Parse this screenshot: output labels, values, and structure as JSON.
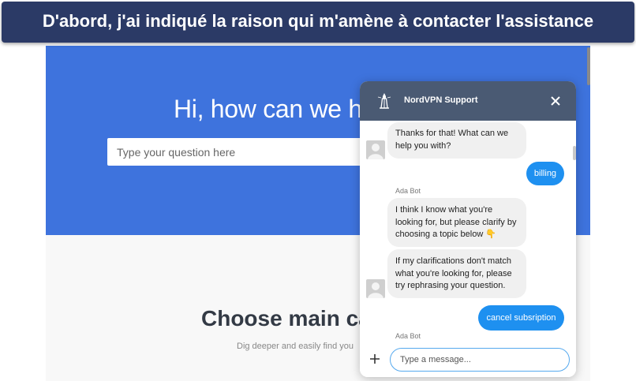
{
  "banner": {
    "text": "D'abord, j'ai indiqué la raison qui m'amène à contacter l'assistance"
  },
  "page": {
    "hero_title": "Hi, how can we h",
    "search_placeholder": "Type your question here",
    "categories_title": "Choose main ca",
    "categories_subtitle": "Dig deeper and easily find you"
  },
  "chat": {
    "title": "NordVPN Support",
    "accent_color": "#1e90f0",
    "header_color": "#4a5a73",
    "messages": [
      {
        "from": "bot",
        "lines": [
          "Thanks for that! What can we",
          "help you with?"
        ]
      },
      {
        "from": "user",
        "text": "billing"
      },
      {
        "from": "bot",
        "sender": "Ada Bot"
      },
      {
        "from": "bot",
        "lines": [
          "I think I know what you're",
          "looking for, but please clarify by",
          "choosing a topic below 👇"
        ]
      },
      {
        "from": "bot",
        "lines": [
          "If my clarifications don't match",
          "what you're looking for, please",
          "try rephrasing your question."
        ]
      },
      {
        "from": "user",
        "text": "cancel subsription"
      },
      {
        "from": "bot",
        "sender": "Ada Bot"
      }
    ],
    "input_placeholder": "Type a message..."
  },
  "icons": {
    "logo": "nordvpn-lighthouse-icon",
    "close": "close-icon",
    "add": "plus-icon",
    "avatar": "user-avatar-icon"
  }
}
